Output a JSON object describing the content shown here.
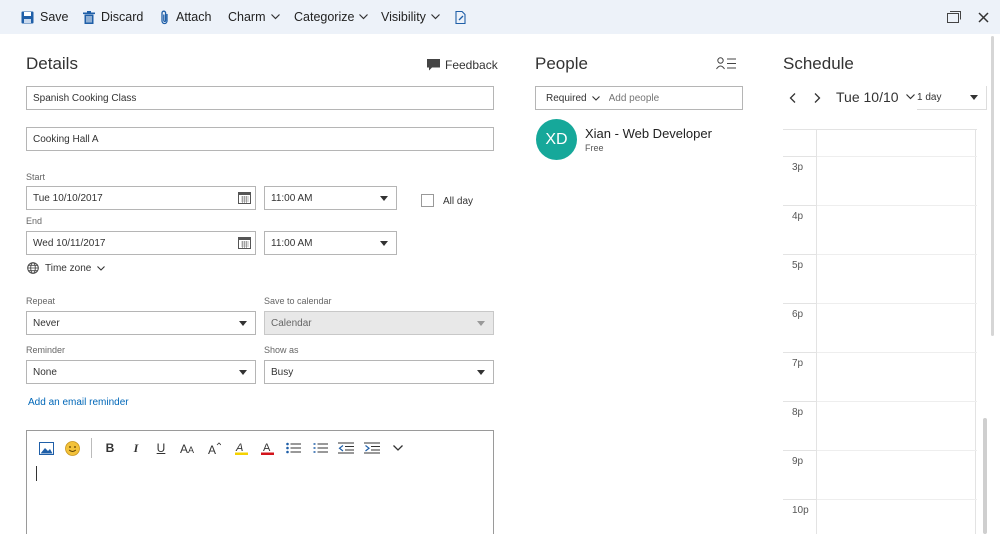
{
  "toolbar": {
    "save": "Save",
    "discard": "Discard",
    "attach": "Attach",
    "charm": "Charm",
    "categorize": "Categorize",
    "visibility": "Visibility"
  },
  "details": {
    "title": "Details",
    "feedback": "Feedback",
    "event_title": "Spanish Cooking Class",
    "location": "Cooking Hall A",
    "start_label": "Start",
    "start_date": "Tue 10/10/2017",
    "start_time": "11:00 AM",
    "all_day": "All day",
    "end_label": "End",
    "end_date": "Wed 10/11/2017",
    "end_time": "11:00 AM",
    "time_zone": "Time zone",
    "repeat_label": "Repeat",
    "repeat_value": "Never",
    "save_to_calendar_label": "Save to calendar",
    "save_to_calendar_value": "Calendar",
    "reminder_label": "Reminder",
    "reminder_value": "None",
    "show_as_label": "Show as",
    "show_as_value": "Busy",
    "email_reminder": "Add an email reminder"
  },
  "editor": {
    "bold": "B",
    "italic": "I",
    "underline": "U"
  },
  "people": {
    "title": "People",
    "required": "Required",
    "add_placeholder": "Add people",
    "attendee": {
      "initials": "XD",
      "name": "Xian - Web Developer",
      "status": "Free"
    }
  },
  "schedule": {
    "title": "Schedule",
    "date": "Tue 10/10",
    "view": "1 day",
    "hours": [
      "3p",
      "4p",
      "5p",
      "6p",
      "7p",
      "8p",
      "9p",
      "10p"
    ]
  },
  "colors": {
    "toolbar_bg": "#edf2f9",
    "accent": "#0067b8",
    "avatar": "#16a89a"
  }
}
